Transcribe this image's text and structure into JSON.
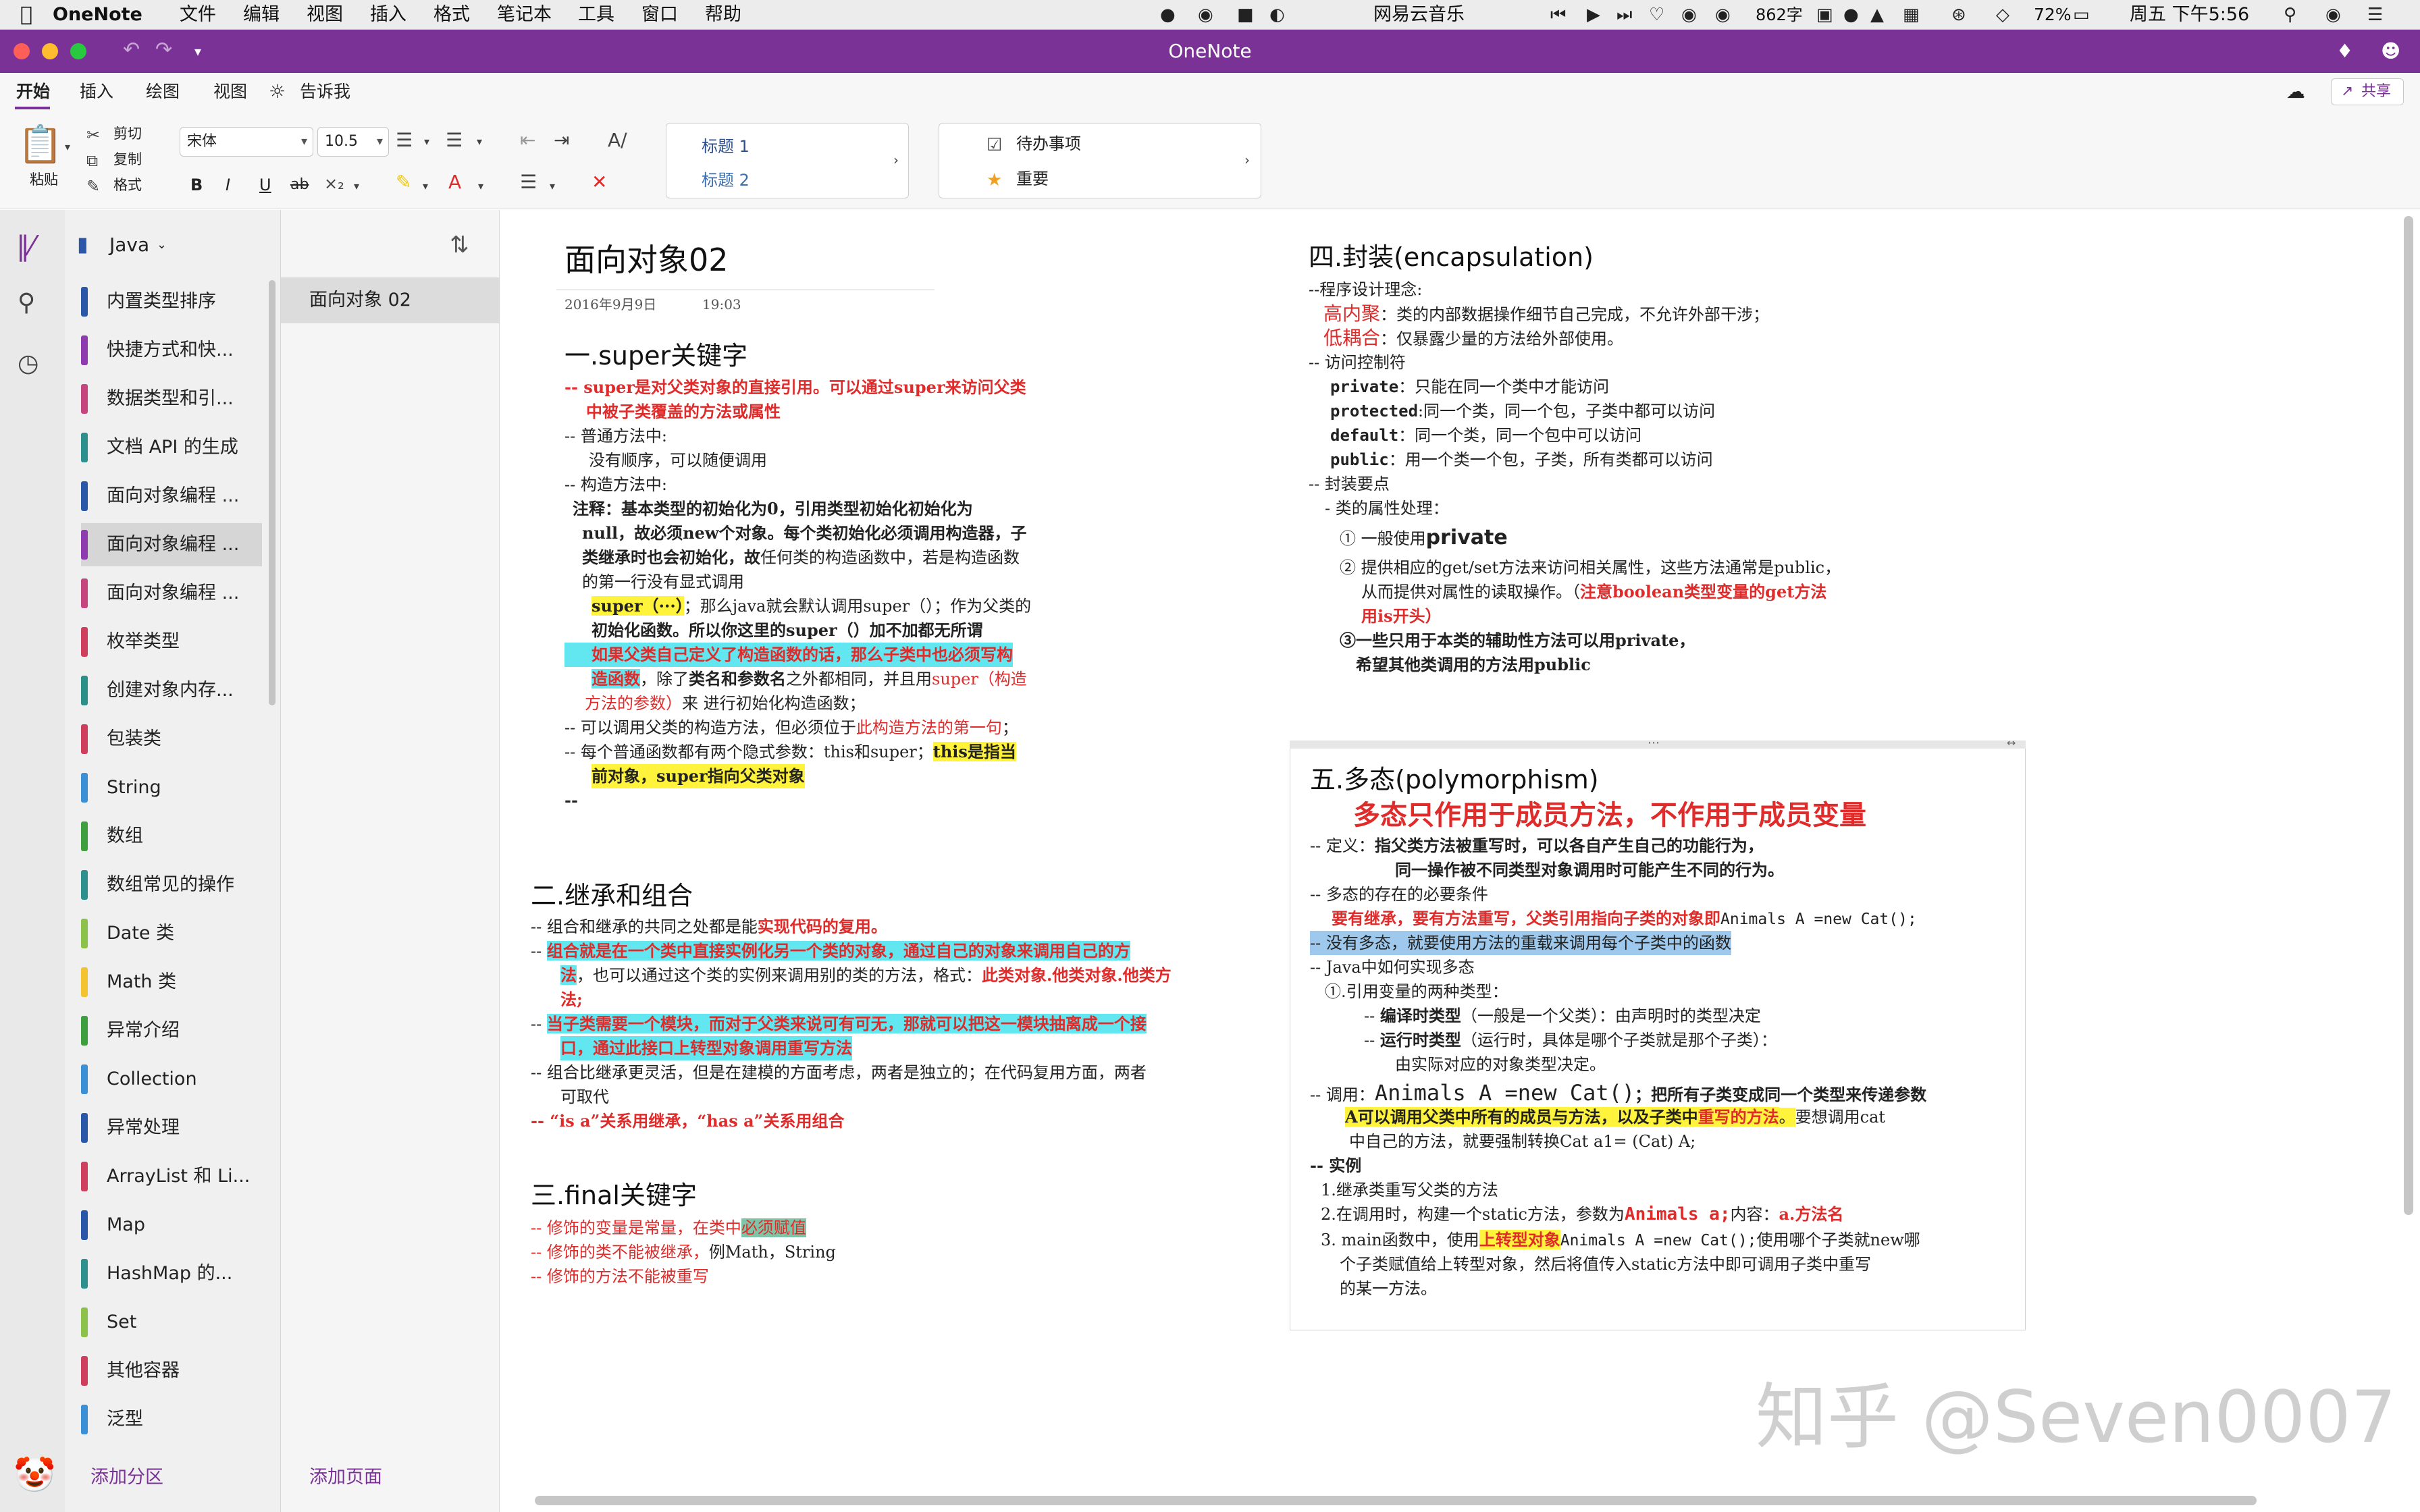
{
  "menubar": {
    "app": "OneNote",
    "menus": [
      "文件",
      "编辑",
      "视图",
      "插入",
      "格式",
      "笔记本",
      "工具",
      "窗口",
      "帮助"
    ],
    "music": "网易云音乐",
    "wordcount": "862字",
    "battery": "72%",
    "datetime": "周五 下午5:56"
  },
  "window": {
    "title": "OneNote"
  },
  "tabs": [
    "开始",
    "插入",
    "绘图",
    "视图"
  ],
  "tellme": "告诉我",
  "share": "共享",
  "ribbon": {
    "paste": "粘贴",
    "cut": "剪切",
    "copy": "复制",
    "format": "格式",
    "font": "宋体",
    "size": "10.5",
    "bold": "B",
    "italic": "I",
    "underline": "U",
    "strike": "ab",
    "style1": "标题 1",
    "style2": "标题 2",
    "todo": "待办事项",
    "important": "重要"
  },
  "notebook": {
    "name": "Java"
  },
  "sections": [
    {
      "label": "内置类型排序",
      "color": "#2b57a8"
    },
    {
      "label": "快捷方式和快...",
      "color": "#8e3bb0"
    },
    {
      "label": "数据类型和引...",
      "color": "#c7457e"
    },
    {
      "label": "文档 API 的生成",
      "color": "#2e8f8f"
    },
    {
      "label": "面向对象编程 ...",
      "color": "#2b57a8"
    },
    {
      "label": "面向对象编程 ...",
      "color": "#8e3bb0"
    },
    {
      "label": "面向对象编程 ...",
      "color": "#c7457e"
    },
    {
      "label": "枚举类型",
      "color": "#cf3e5c"
    },
    {
      "label": "创建对象内存...",
      "color": "#2b8f8a"
    },
    {
      "label": "包装类",
      "color": "#cf3e5c"
    },
    {
      "label": "String",
      "color": "#3a8fd6"
    },
    {
      "label": "数组",
      "color": "#3e9f3e"
    },
    {
      "label": "数组常见的操作",
      "color": "#2e8f8f"
    },
    {
      "label": "Date 类",
      "color": "#8bc34a"
    },
    {
      "label": "Math 类",
      "color": "#f4c430"
    },
    {
      "label": "异常介绍",
      "color": "#3e9f3e"
    },
    {
      "label": "Collection",
      "color": "#3a8fd6"
    },
    {
      "label": "异常处理",
      "color": "#2b57a8"
    },
    {
      "label": "ArrayList 和 Li...",
      "color": "#cf3e5c"
    },
    {
      "label": "Map",
      "color": "#2b57a8"
    },
    {
      "label": "HashMap 的...",
      "color": "#2e8f8f"
    },
    {
      "label": "Set",
      "color": "#8bc34a"
    },
    {
      "label": "其他容器",
      "color": "#cf3e5c"
    },
    {
      "label": "泛型",
      "color": "#3a8fd6"
    }
  ],
  "pages": [
    "面向对象 02"
  ],
  "add_section": "添加分区",
  "add_page": "添加页面",
  "note": {
    "title": "面向对象02",
    "date": "2016年9月9日",
    "time": "19:03",
    "s1": {
      "h": "一.super关键字",
      "l1a": "-- super是对父类对象的直接引用。可以通过super来访问父类",
      "l1b": "中被子类覆盖的方法或属性",
      "l2": "-- 普通方法中:",
      "l3": "没有顺序，可以随便调用",
      "l4": "-- 构造方法中:",
      "l5": "注释：基本类型的初始化为0，引用类型初始化初始化为",
      "l6": "null，故必须new个对象。每个类初始化必须调用构造器，子",
      "l7a": "类继承时也会初始化，故",
      "l7b": "任何类的构造函数中，若是构造函数",
      "l8": "的第一行没有显式调用",
      "l9a": "super（···）",
      "l9b": "；那么java就会默认调用super（）；作为父类的",
      "l10": "初始化函数。所以你这里的super（）加不加都无所谓",
      "l11": "如果父类自己定义了构造函数的话，那么子类中也必须写构",
      "l12a": "造函数",
      "l12b": "，除了",
      "l12c": "类名和参数名",
      "l12d": "之外都相同，并且用",
      "l12e": "super（构造",
      "l13a": "方法的参数）",
      "l13b": "来 进行初始化构造函数；",
      "l14a": "-- 可以调用父类的构造方法，但必须位于",
      "l14b": "此构造方法的第一句",
      "l14c": "；",
      "l15a": "-- 每个普通函数都有两个隐式参数：this和super；",
      "l15b": "this是指当",
      "l16": "前对象，super指向父类对象",
      "l17": "--"
    },
    "s2": {
      "h": "二.继承和组合",
      "l1a": "-- 组合和继承的共同之处都是能",
      "l1b": "实现代码的复用。",
      "l2a": "-- ",
      "l2b": "组合就是在一个类中直接实例化另一个类的对象，通过自己的对象来调用自己的方",
      "l3a": "法",
      "l3b": "，也可以通过这个类的实例来调用别的类的方法，格式：",
      "l3c": "此类对象.他类对象.他类方",
      "l4": "法;",
      "l5a": "-- ",
      "l5b": "当子类需要一个模块，而对于父类来说可有可无，那就可以把这一模块抽离成一个接",
      "l6": "口，通过此接口上转型对象调用重写方法",
      "l7": "-- 组合比继承更灵活，但是在建模的方面考虑，两者是独立的；在代码复用方面，两者",
      "l8": "可取代",
      "l9": "-- “is a”关系用继承，“has a”关系用组合"
    },
    "s3": {
      "h": "三.final关键字",
      "l1a": "-- 修饰的变量是常量，在类中",
      "l1b": "必须赋值",
      "l2a": "-- 修饰的类不能被继承，",
      "l2b": "例Math，String",
      "l3": "-- 修饰的方法不能被重写"
    },
    "s4": {
      "h": "四.封装(encapsulation)",
      "l1": "--程序设计理念:",
      "l2a": "高内聚",
      "l2b": "：类的内部数据操作细节自己完成，不允许外部干涉；",
      "l3a": "低耦合",
      "l3b": "：仅暴露少量的方法给外部使用。",
      "l4": "-- 访问控制符",
      "l5a": "private",
      "l5b": "：只能在同一个类中才能访问",
      "l6a": "protected",
      "l6b": ":同一个类，同一个包，子类中都可以访问",
      "l7a": "default",
      "l7b": "：同一个类，同一个包中可以访问",
      "l8a": "public",
      "l8b": "：用一个类一个包，子类，所有类都可以访问",
      "l9": "-- 封装要点",
      "l10": "- 类的属性处理：",
      "l11a": "①  一般使用",
      "l11b": "private",
      "l12": "②  提供相应的get/set方法来访问相关属性，这些方法通常是public，",
      "l13a": "从而提供对属性的读取操作。（",
      "l13b": "注意boolean类型变量的get方法",
      "l14": "用is开头）",
      "l15a": "③",
      "l15b": "一些只用于本类的辅助性方法可以用private，",
      "l16": "希望其他类调用的方法用public"
    },
    "s5": {
      "h": "五.多态(polymorphism)",
      "sub": "多态只作用于成员方法，不作用于成员变量",
      "l1a": "-- 定义：",
      "l1b": "指父类方法被重写时，可以各自产生自己的功能行为，",
      "l2": "同一操作被不同类型对象调用时可能产生不同的行为。",
      "l3": "-- 多态的存在的必要条件",
      "l4a": "要有继承，要有方法重写，父类引用指向子类的对象即",
      "l4b": "Animals A =new Cat();",
      "l5": "-- 没有多态，就要使用方法的重载来调用每个子类中的函数",
      "l6": "-- Java中如何实现多态",
      "l7": "①.引用变量的两种类型：",
      "l8a": "-- ",
      "l8b": "编译时类型",
      "l8c": "（一般是一个父类）：由声明时的类型决定",
      "l9a": "-- ",
      "l9b": "运行时类型",
      "l9c": "（运行时，具体是哪个子类就是那个子类）：",
      "l10": "由实际对应的对象类型决定。",
      "l11a": "-- 调用：",
      "l11b": "Animals A =new Cat()",
      "l11c": "；把所有子类变成同一个类型来传递参数",
      "l12a": "A可以调用父类中所有的成员与方法，以及子类中",
      "l12b": "重写的方法",
      "l12c": "。",
      "l12d": "要想调用cat",
      "l13": "中自己的方法，就要强制转换Cat a1= (Cat) A;",
      "l14": "-- 实例",
      "l15": "1.继承类重写父类的方法",
      "l16a": "2.在调用时，构建一个static方法，参数为",
      "l16b": "Animals a;",
      "l16c": "内容：",
      "l16d": "a.方法名",
      "l17a": "3. main函数中，使用",
      "l17b": "上转型对象",
      "l17c": "Animals A =new Cat();",
      "l17d": "使用哪个子类就new哪",
      "l18": "个子类赋值给上转型对象，然后将值传入static方法中即可调用子类中重写",
      "l19": "的某一方法。"
    }
  },
  "watermark": "知乎 @Seven0007"
}
